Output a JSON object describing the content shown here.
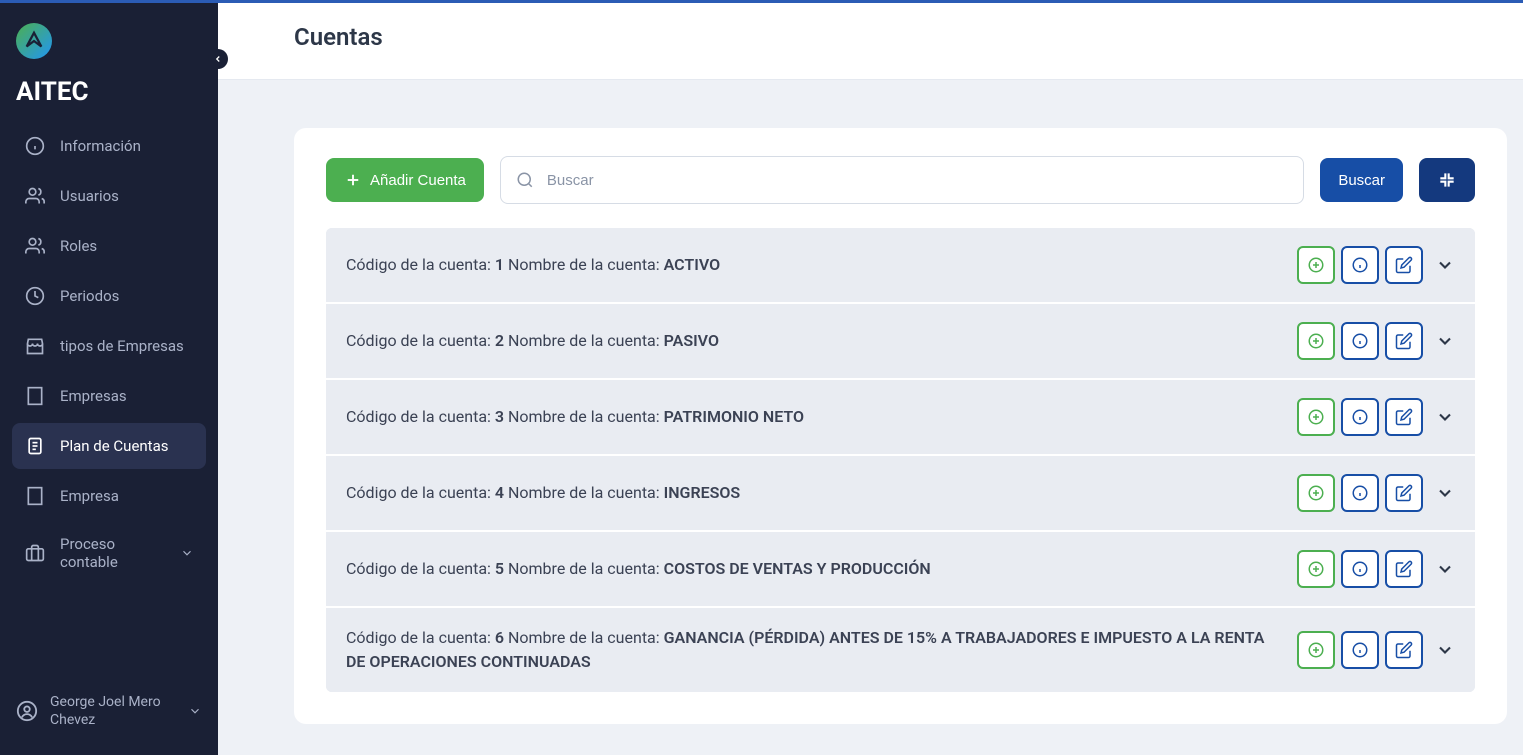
{
  "brand": "AITEC",
  "sidebar": {
    "items": [
      {
        "label": "Información",
        "icon": "info"
      },
      {
        "label": "Usuarios",
        "icon": "users"
      },
      {
        "label": "Roles",
        "icon": "roles"
      },
      {
        "label": "Periodos",
        "icon": "clock"
      },
      {
        "label": "tipos de Empresas",
        "icon": "store"
      },
      {
        "label": "Empresas",
        "icon": "building"
      },
      {
        "label": "Plan de Cuentas",
        "icon": "clipboard"
      },
      {
        "label": "Empresa",
        "icon": "building"
      },
      {
        "label": "Proceso contable",
        "icon": "briefcase"
      }
    ],
    "active_index": 6
  },
  "user": {
    "name": "George Joel Mero Chevez"
  },
  "header": {
    "title": "Cuentas"
  },
  "toolbar": {
    "add_label": "Añadir Cuenta",
    "search_placeholder": "Buscar",
    "search_button": "Buscar"
  },
  "labels": {
    "code": "Código de la cuenta:",
    "name": "Nombre de la cuenta:"
  },
  "accounts": [
    {
      "code": "1",
      "name": "ACTIVO"
    },
    {
      "code": "2",
      "name": "PASIVO"
    },
    {
      "code": "3",
      "name": "PATRIMONIO NETO"
    },
    {
      "code": "4",
      "name": "INGRESOS"
    },
    {
      "code": "5",
      "name": "COSTOS DE VENTAS Y PRODUCCIÓN"
    },
    {
      "code": "6",
      "name": "GANANCIA (PÉRDIDA) ANTES DE 15% A TRABAJADORES E IMPUESTO A LA RENTA DE OPERACIONES CONTINUADAS"
    }
  ],
  "colors": {
    "sidebar_bg": "#1a2035",
    "accent_blue": "#174ea6",
    "accent_green": "#4caf50"
  }
}
